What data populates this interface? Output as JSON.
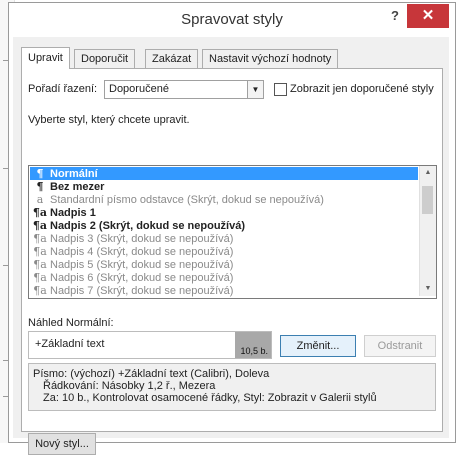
{
  "dialog": {
    "title": "Spravovat styly",
    "help": "?",
    "close": "✕"
  },
  "tabs": [
    {
      "label": "Upravit",
      "active": true
    },
    {
      "label": "Doporučit",
      "active": false
    },
    {
      "label": "Zakázat",
      "active": false
    },
    {
      "label": "Nastavit výchozí hodnoty",
      "active": false
    }
  ],
  "sort": {
    "label": "Pořadí řazení:",
    "value": "Doporučené",
    "recommended_only_label": "Zobrazit jen doporučené styly",
    "recommended_only_checked": false
  },
  "style_list": {
    "prompt": "Vyberte styl, který chcete upravit.",
    "items": [
      {
        "icon": "¶",
        "label": "Normální",
        "selected": true,
        "muted": false,
        "bold": true
      },
      {
        "icon": "¶",
        "label": "Bez mezer",
        "selected": false,
        "muted": false,
        "bold": true
      },
      {
        "icon": "a",
        "label": "Standardní písmo odstavce  (Skrýt, dokud se nepoužívá)",
        "selected": false,
        "muted": true,
        "bold": false
      },
      {
        "icon": "¶a",
        "label": "Nadpis 1",
        "selected": false,
        "muted": false,
        "bold": true
      },
      {
        "icon": "¶a",
        "label": "Nadpis 2  (Skrýt, dokud se nepoužívá)",
        "selected": false,
        "muted": false,
        "bold": true
      },
      {
        "icon": "¶a",
        "label": "Nadpis 3  (Skrýt, dokud se nepoužívá)",
        "selected": false,
        "muted": true,
        "bold": false
      },
      {
        "icon": "¶a",
        "label": "Nadpis 4  (Skrýt, dokud se nepoužívá)",
        "selected": false,
        "muted": true,
        "bold": false
      },
      {
        "icon": "¶a",
        "label": "Nadpis 5  (Skrýt, dokud se nepoužívá)",
        "selected": false,
        "muted": true,
        "bold": false
      },
      {
        "icon": "¶a",
        "label": "Nadpis 6  (Skrýt, dokud se nepoužívá)",
        "selected": false,
        "muted": true,
        "bold": false
      },
      {
        "icon": "¶a",
        "label": "Nadpis 7  (Skrýt, dokud se nepoužívá)",
        "selected": false,
        "muted": true,
        "bold": false
      }
    ]
  },
  "preview": {
    "label": "Náhled Normální:",
    "text": "+Základní text",
    "size": "10,5 b."
  },
  "buttons": {
    "modify": "Změnit...",
    "delete": "Odstranit",
    "new_style": "Nový styl..."
  },
  "description": {
    "line1": "Písmo: (výchozí) +Základní text (Calibri), Doleva",
    "line2": "Řádkování:  Násobky 1,2 ř., Mezera",
    "line3": "Za:  10 b., Kontrolovat osamocené řádky, Styl: Zobrazit v Galerii stylů"
  },
  "colors": {
    "selection": "#3399ff",
    "close": "#c7363a"
  }
}
